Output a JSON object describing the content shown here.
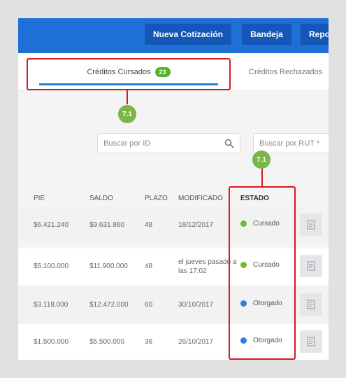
{
  "topbar": {
    "nueva_label": "Nueva Cotización",
    "bandeja_label": "Bandeja",
    "repo_label": "Repo"
  },
  "tabs": {
    "cursados_label": "Créditos Cursados",
    "cursados_count": "23",
    "rechazados_label": "Créditos Rechazados"
  },
  "callouts": {
    "tab_step": "7.1",
    "column_step": "7.1"
  },
  "search": {
    "id_placeholder": "Buscar por ID",
    "rut_placeholder": "Buscar por RUT *"
  },
  "table": {
    "headers": {
      "pie": "PIE",
      "saldo": "SALDO",
      "plazo": "PLAZO",
      "modificado": "MODIFICADO",
      "estado": "ESTADO"
    },
    "rows": [
      {
        "pie": "$6.421.240",
        "saldo": "$9.631.860",
        "plazo": "48",
        "modificado": "18/12/2017",
        "estado": "Cursado"
      },
      {
        "pie": "$5.100.000",
        "saldo": "$11.900.000",
        "plazo": "48",
        "modificado": "el jueves pasado a las 17:02",
        "estado": "Cursado"
      },
      {
        "pie": "$3.118.000",
        "saldo": "$12.472.000",
        "plazo": "60",
        "modificado": "30/10/2017",
        "estado": "Otorgado"
      },
      {
        "pie": "$1.500.000",
        "saldo": "$5.500.000",
        "plazo": "36",
        "modificado": "26/10/2017",
        "estado": "Otorgado"
      }
    ]
  },
  "colors": {
    "topbar": "#1e6fd6",
    "nav_button": "#1556b8",
    "accent_underline": "#2a7fd8",
    "badge_green": "#55b12e",
    "callout_red": "#d71920",
    "step_green": "#7ab648",
    "status_cursado": "#6fba2c",
    "status_otorgado": "#2f7fe0"
  },
  "icons": {
    "search": "search-icon",
    "document": "document-icon"
  }
}
